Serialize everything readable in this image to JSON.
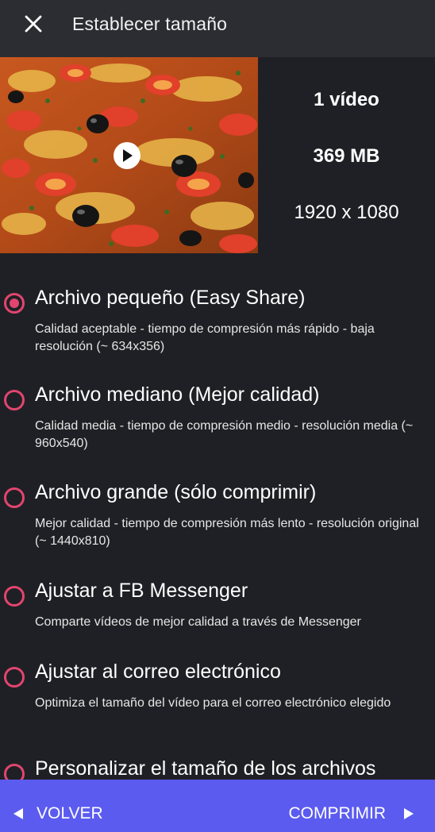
{
  "header": {
    "title": "Establecer tamaño",
    "close_icon": "close-icon"
  },
  "media": {
    "thumbnail_icon": "play-icon",
    "video_count": "1 vídeo",
    "file_size": "369 MB",
    "resolution": "1920 x 1080"
  },
  "options": [
    {
      "label": "Archivo pequeño (Easy Share)",
      "description": "Calidad aceptable - tiempo de compresión más rápido - baja resolución (~ 634x356)",
      "selected": true
    },
    {
      "label": "Archivo mediano (Mejor calidad)",
      "description": "Calidad media - tiempo de compresión medio - resolución media (~ 960x540)",
      "selected": false
    },
    {
      "label": "Archivo grande (sólo comprimir)",
      "description": "Mejor calidad - tiempo de compresión más lento - resolución original (~ 1440x810)",
      "selected": false
    },
    {
      "label": "Ajustar a FB Messenger",
      "description": "Comparte vídeos de mejor calidad a través de Messenger",
      "selected": false
    },
    {
      "label": "Ajustar al correo electrónico",
      "description": "Optimiza el tamaño del vídeo para el correo electrónico elegido",
      "selected": false
    },
    {
      "label": "Personalizar el tamaño de los archivos",
      "description": "",
      "selected": false
    }
  ],
  "footer": {
    "back_label": "VOLVER",
    "compress_label": "COMPRIMIR"
  },
  "colors": {
    "background": "#1f2025",
    "header": "#2b2d33",
    "accent_radio": "#e2456f",
    "footer": "#5b5bf0"
  }
}
